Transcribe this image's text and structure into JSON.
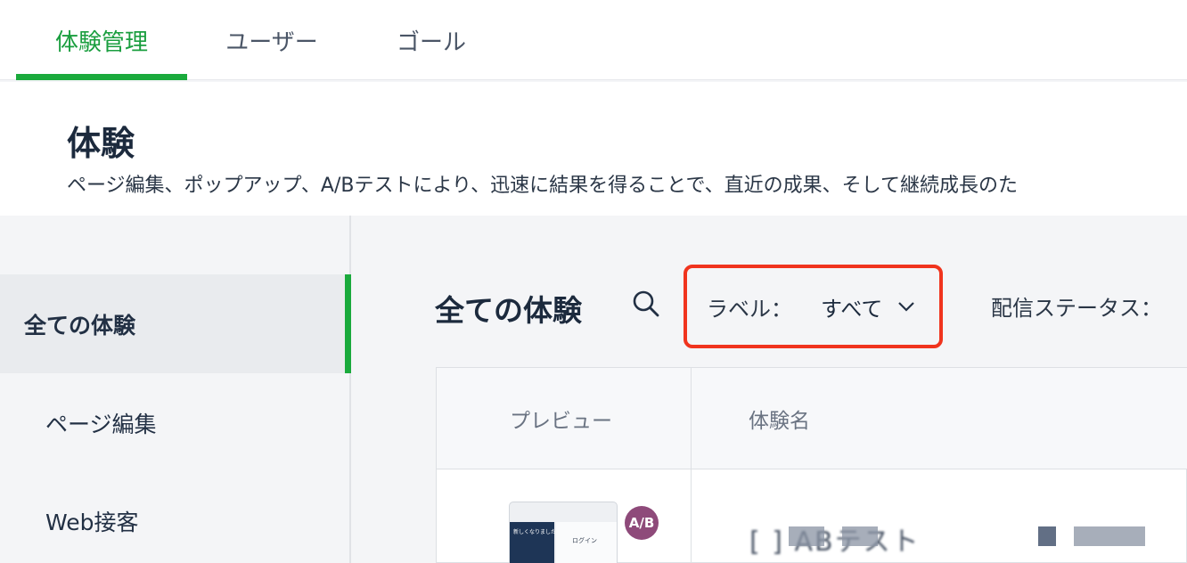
{
  "topnav": {
    "tabs": [
      {
        "label": "体験管理",
        "active": true
      },
      {
        "label": "ユーザー",
        "active": false
      },
      {
        "label": "ゴール",
        "active": false
      }
    ]
  },
  "header": {
    "title": "体験",
    "description": "ページ編集、ポップアップ、A/Bテストにより、迅速に結果を得ることで、直近の成果、そして継続成長のた"
  },
  "sidebar": {
    "items": [
      {
        "label": "全ての体験",
        "active": true
      },
      {
        "label": "ページ編集",
        "active": false
      },
      {
        "label": "Web接客",
        "active": false
      }
    ]
  },
  "main": {
    "title": "全ての体験",
    "filter_label": {
      "label": "ラベル：",
      "value": "すべて"
    },
    "status_filter": {
      "label": "配信ステータス："
    },
    "table": {
      "columns": [
        "プレビュー",
        "体験名"
      ],
      "rows": [
        {
          "preview": {
            "login_text": "ログイン",
            "hero_text": "新しくなりました！"
          },
          "badge": "A/B",
          "name": "[ ]    ABテスト"
        }
      ]
    }
  },
  "colors": {
    "accent_green": "#1aaa3c",
    "highlight_red": "#f0341e",
    "ab_badge": "#8e4a7a"
  }
}
